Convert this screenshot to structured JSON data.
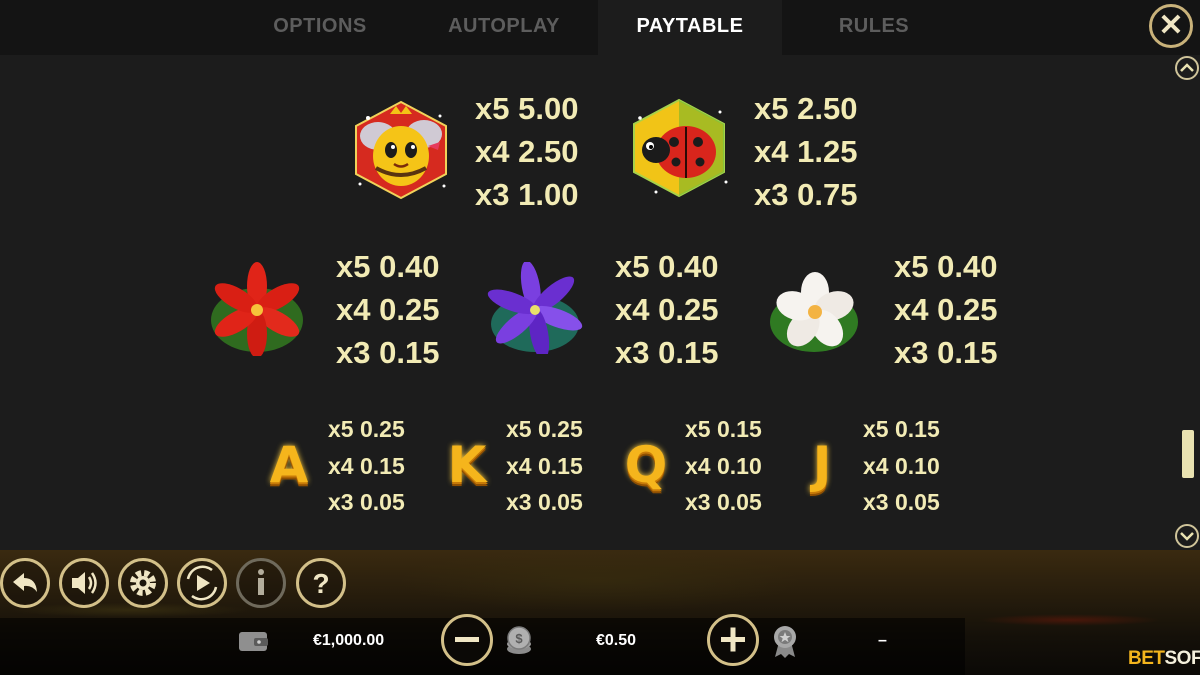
{
  "tabs": [
    "OPTIONS",
    "AUTOPLAY",
    "PAYTABLE",
    "RULES"
  ],
  "active_tab": "PAYTABLE",
  "paytable": {
    "bee": [
      "x5 5.00",
      "x4 2.50",
      "x3 1.00"
    ],
    "ladybug": [
      "x5 2.50",
      "x4 1.25",
      "x3 0.75"
    ],
    "red_flower": [
      "x5 0.40",
      "x4 0.25",
      "x3 0.15"
    ],
    "purple_flower": [
      "x5 0.40",
      "x4 0.25",
      "x3 0.15"
    ],
    "white_flower": [
      "x5 0.40",
      "x4 0.25",
      "x3 0.15"
    ],
    "a": {
      "letter": "A",
      "pays": [
        "x5 0.25",
        "x4 0.15",
        "x3 0.05"
      ]
    },
    "k": {
      "letter": "K",
      "pays": [
        "x5 0.25",
        "x4 0.15",
        "x3 0.05"
      ]
    },
    "q": {
      "letter": "Q",
      "pays": [
        "x5 0.15",
        "x4 0.10",
        "x3 0.05"
      ]
    },
    "j": {
      "letter": "J",
      "pays": [
        "x5 0.15",
        "x4 0.10",
        "x3 0.05"
      ]
    }
  },
  "footer": {
    "balance": "€1,000.00",
    "bet": "€0.50",
    "win": "–",
    "logo_left": "BET",
    "logo_right": "SOFT"
  },
  "icons": {
    "close": "close-icon",
    "back": "back-arrow-icon",
    "sound": "speaker-icon",
    "settings": "gear-icon",
    "autoplay": "autoplay-icon",
    "info": "info-icon",
    "help": "question-icon",
    "wallet": "wallet-icon",
    "coins": "coin-stack-icon",
    "award": "award-icon"
  },
  "colors": {
    "accent_gold": "#d3c089",
    "pay_text": "#f2ebb5",
    "letter_gold": "#f5b51c"
  }
}
